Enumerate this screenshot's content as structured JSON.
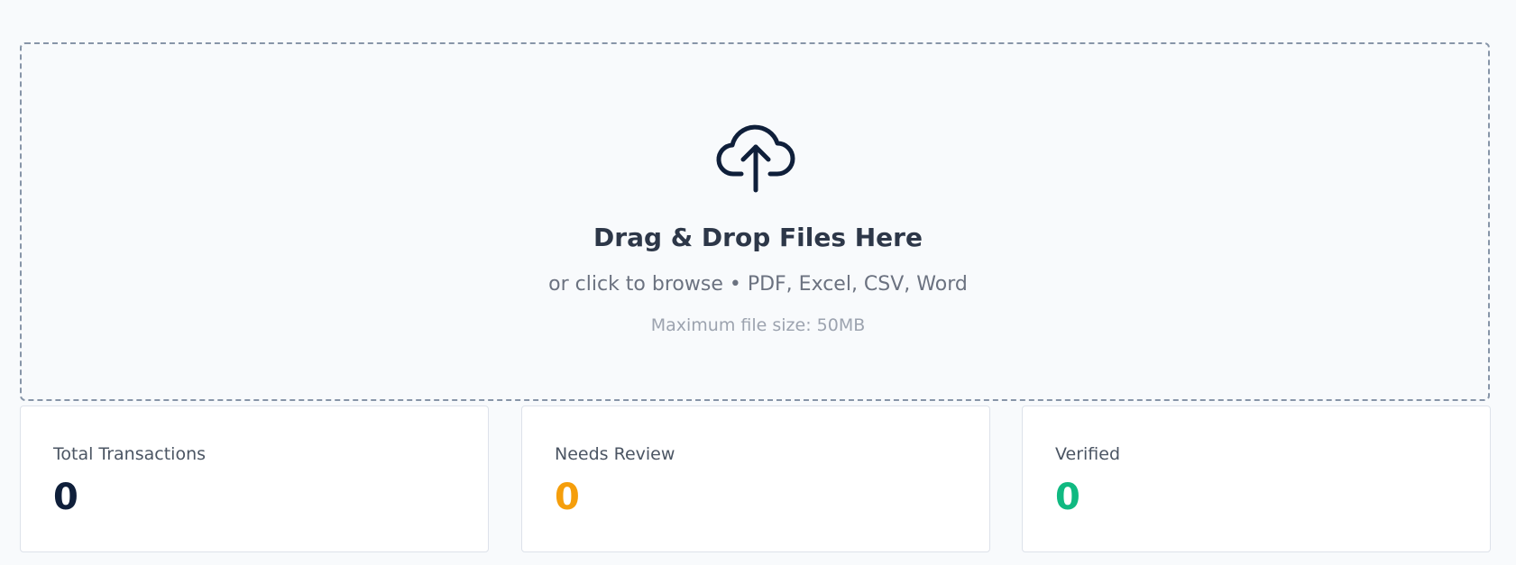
{
  "upload": {
    "icon": "cloud-upload-icon",
    "title": "Drag & Drop Files Here",
    "subtitle": "or click to browse • PDF, Excel, CSV, Word",
    "limit": "Maximum file size: 50MB",
    "icon_color": "#0f1f3a",
    "border_color": "#8795a8"
  },
  "stats": [
    {
      "label": "Total Transactions",
      "value": "0",
      "color": "#0f1f3a"
    },
    {
      "label": "Needs Review",
      "value": "0",
      "color": "#f59e0b"
    },
    {
      "label": "Verified",
      "value": "0",
      "color": "#10b981"
    }
  ]
}
